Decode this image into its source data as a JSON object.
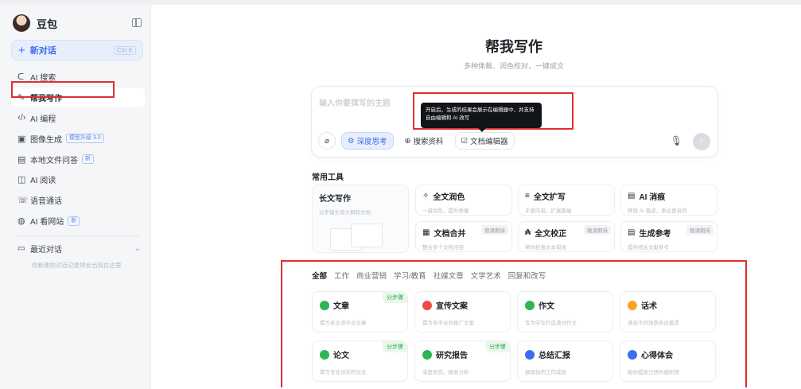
{
  "sidebar": {
    "brand": "豆包",
    "new_chat": {
      "label": "新对话",
      "shortcut": "Ctrl K"
    },
    "items": [
      {
        "icon": "search-icon",
        "label": "AI 搜索",
        "badge": ""
      },
      {
        "icon": "pen-icon",
        "label": "帮我写作",
        "badge": ""
      },
      {
        "icon": "code-icon",
        "label": "AI 编程",
        "badge": ""
      },
      {
        "icon": "image-icon",
        "label": "图像生成",
        "badge": "模型升级 3.0"
      },
      {
        "icon": "file-icon",
        "label": "本地文件问答",
        "badge": "新"
      },
      {
        "icon": "book-icon",
        "label": "AI 阅读",
        "badge": ""
      },
      {
        "icon": "phone-icon",
        "label": "语音通话",
        "badge": ""
      },
      {
        "icon": "globe-icon",
        "label": "AI 看网站",
        "badge": "新"
      }
    ],
    "recent": {
      "label": "最近对话",
      "hint": "你新建的对话记录将会出现在这里"
    }
  },
  "main": {
    "title": "帮我写作",
    "subtitle": "多种体裁、润色校对，一键成文",
    "composer": {
      "placeholder": "输入你要撰写的主题",
      "tooltip": "开启后，生成的结果会展示在编辑器中，并支持自由编辑和 AI 改写",
      "deep_think": "深度思考",
      "search": "搜索资料",
      "doc_editor": "文档编辑器"
    },
    "tools_title": "常用工具",
    "tools": {
      "long": {
        "name": "长文写作",
        "desc": "分步骤生成大纲和文档"
      },
      "items": [
        {
          "name": "全文润色",
          "desc": "一键润色，提升质量",
          "soon": ""
        },
        {
          "name": "全文扩写",
          "desc": "丰富内容，扩展篇幅",
          "soon": ""
        },
        {
          "name": "AI 消痕",
          "desc": "移除 AI 痕迹，表达更自然",
          "soon": ""
        },
        {
          "name": "文档合并",
          "desc": "整合多个文档内容",
          "soon": "敬请期待"
        },
        {
          "name": "全文校正",
          "desc": "帮你检查文本错误",
          "soon": "敬请期待"
        },
        {
          "name": "生成参考",
          "desc": "提供相关文献参考",
          "soon": "敬请期待"
        }
      ]
    },
    "tabs": [
      "全部",
      "工作",
      "商业营销",
      "学习/教育",
      "社媒文章",
      "文学艺术",
      "回复和改写"
    ],
    "cards": [
      {
        "title": "文章",
        "desc": "撰写各主流平台文章",
        "tag": "分步骤",
        "color": "#2fb457"
      },
      {
        "title": "宣传文案",
        "desc": "撰写各平台的推广文案",
        "tag": "",
        "color": "#f04b4b"
      },
      {
        "title": "作文",
        "desc": "专为学生打造满分作文",
        "tag": "",
        "color": "#2fb457"
      },
      {
        "title": "话术",
        "desc": "满足不同场景表达需求",
        "tag": "",
        "color": "#f5a623"
      },
      {
        "title": "论文",
        "desc": "撰写专业详实的论文",
        "tag": "分步骤",
        "color": "#2fb457"
      },
      {
        "title": "研究报告",
        "desc": "深度研究，精准分析",
        "tag": "分步骤",
        "color": "#2fb457"
      },
      {
        "title": "总结汇报",
        "desc": "展现你的工作成效",
        "tag": "",
        "color": "#3a6df0"
      },
      {
        "title": "心得体会",
        "desc": "助你提炼已悟所感所悟",
        "tag": "",
        "color": "#3a6df0"
      }
    ]
  },
  "colors": {
    "accent": "#3a6df0",
    "highlight": "#e02e2e"
  }
}
